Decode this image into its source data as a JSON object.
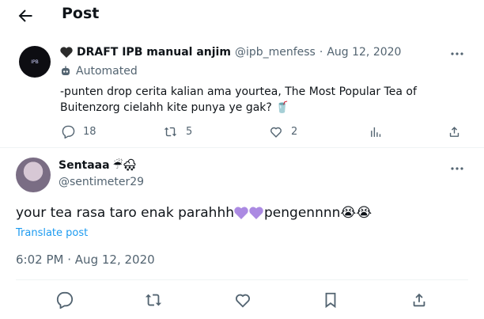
{
  "header": {
    "title": "Post"
  },
  "quoted": {
    "name": "DRAFT IPB manual anjim",
    "handle": "@ipb_menfess",
    "separator": "·",
    "date": "Aug 12, 2020",
    "automated_label": "Automated",
    "text": "-punten drop cerita kalian ama yourtea, The Most Popular Tea of Buitenzorg cielahh kite punya ye gak? 🥤",
    "replies": "18",
    "reposts": "5",
    "likes": "2"
  },
  "post": {
    "name": "Sentaaa",
    "name_emoji": "☔🌨",
    "handle": "@sentimeter29",
    "text_part1": "your tea rasa taro enak parahhh",
    "text_part2": " pengennnn",
    "text_emoji_end": "😭😭",
    "translate": "Translate post",
    "time": "6:02 PM",
    "separator": "·",
    "date": "Aug 12, 2020"
  },
  "colors": {
    "text": "#0f1419",
    "muted": "#536471",
    "link": "#1d9bf0",
    "heart_purple": "#ab8ae2"
  }
}
